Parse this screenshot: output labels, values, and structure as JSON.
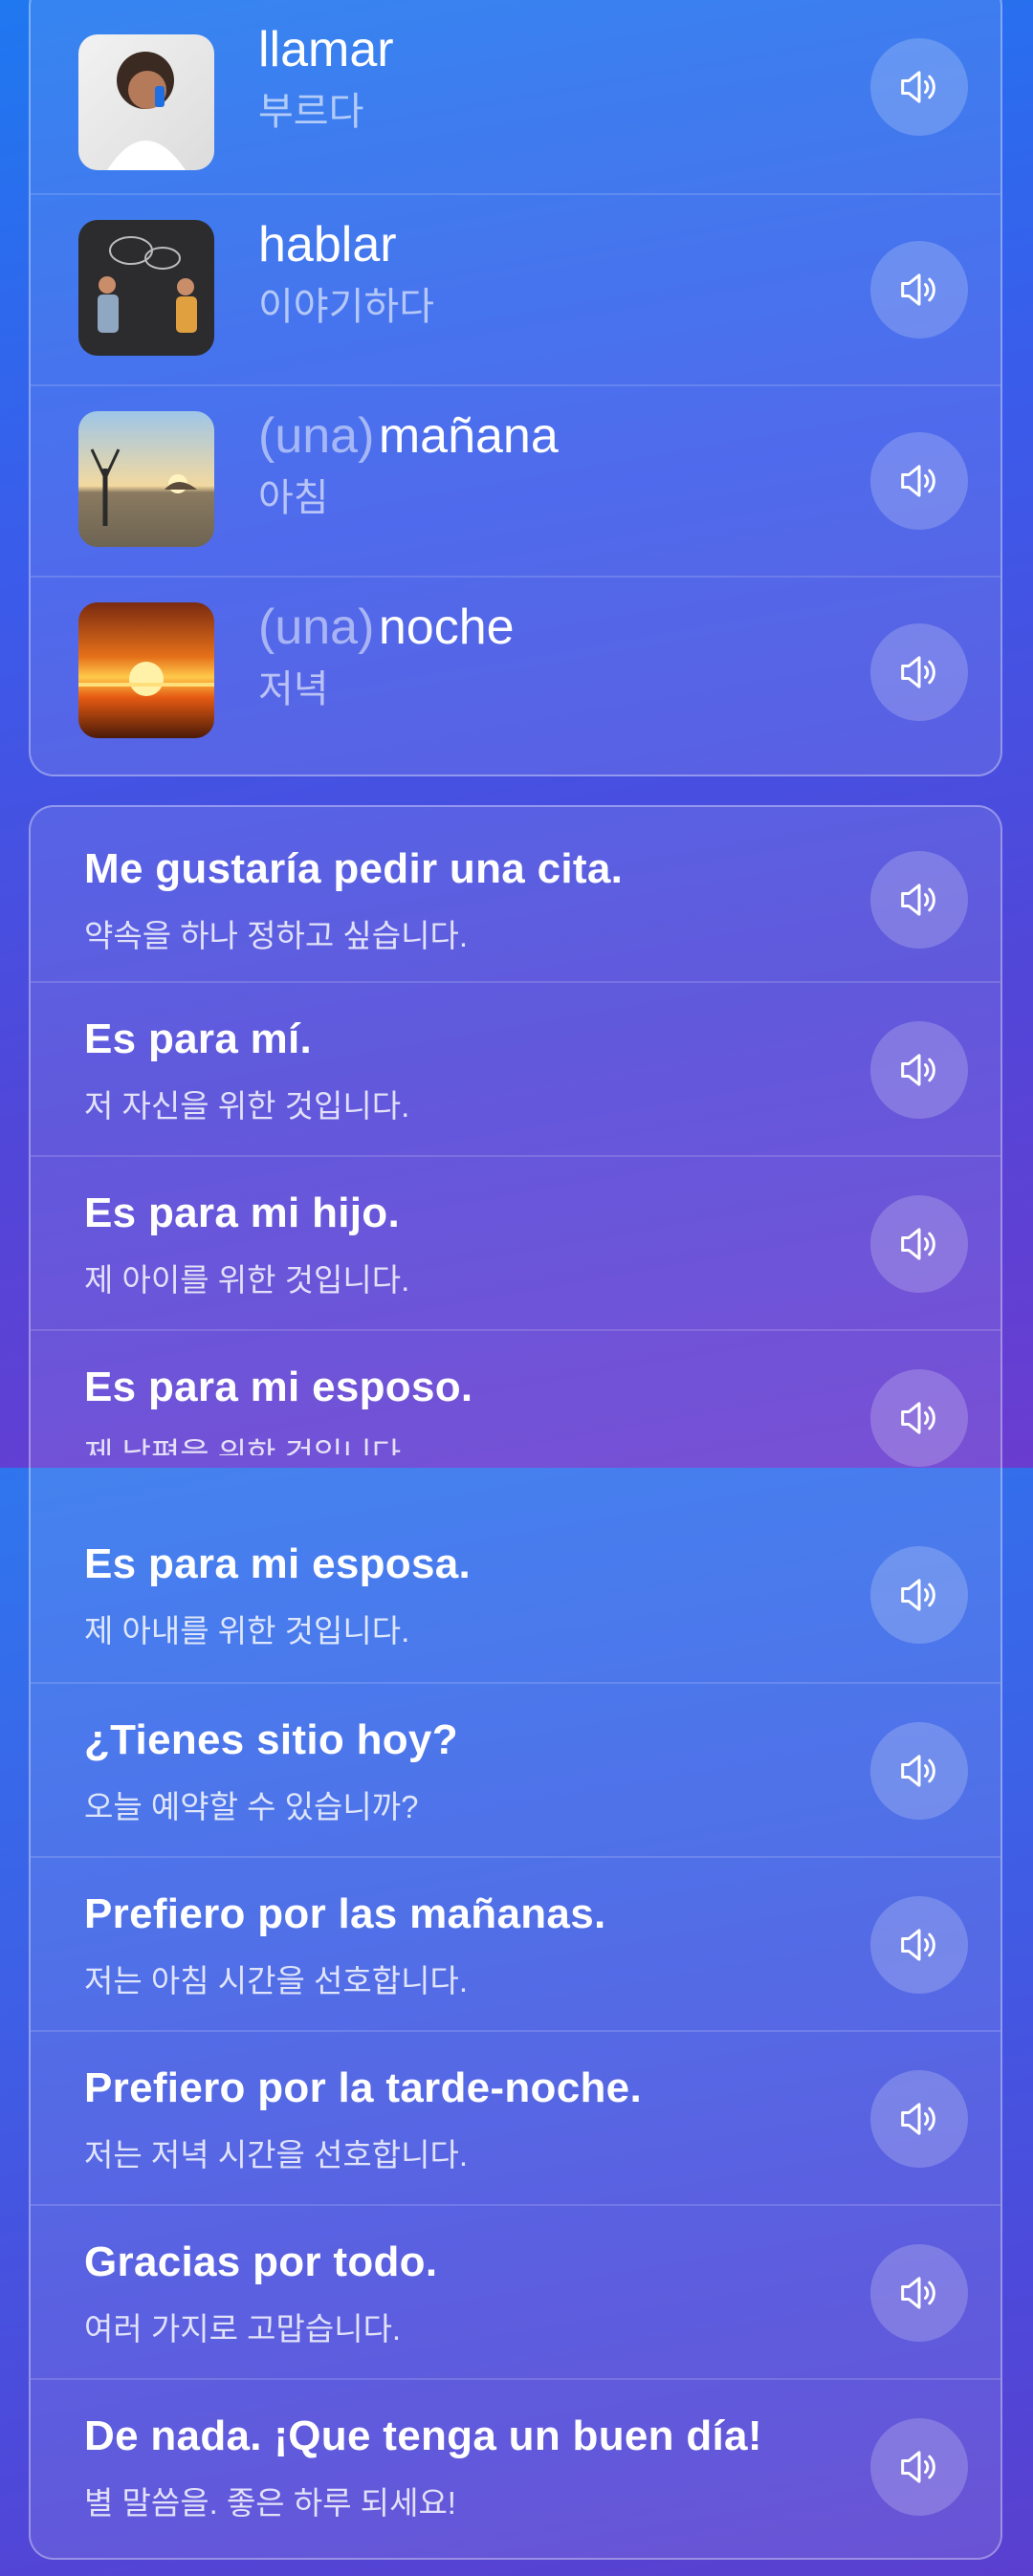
{
  "vocab": [
    {
      "article": "",
      "word": "llamar",
      "gloss": "부르다",
      "icon": "speaker-icon"
    },
    {
      "article": "",
      "word": "hablar",
      "gloss": "이야기하다",
      "icon": "speaker-icon"
    },
    {
      "article": "(una)",
      "word": "mañana",
      "gloss": "아침",
      "icon": "speaker-icon"
    },
    {
      "article": "(una)",
      "word": "noche",
      "gloss": "저녁",
      "icon": "speaker-icon"
    }
  ],
  "phrases": [
    {
      "es": "Me gustaría pedir una cita.",
      "ko": "약속을 하나 정하고 싶습니다."
    },
    {
      "es": "Es para mí.",
      "ko": "저 자신을 위한 것입니다."
    },
    {
      "es": "Es para mi hijo.",
      "ko": "제 아이를 위한 것입니다."
    },
    {
      "es": "Es para mi esposo.",
      "ko": "제 남편을 위한 것입니다."
    },
    {
      "es": "Es para mi esposa.",
      "ko": "제 아내를 위한 것입니다."
    },
    {
      "es": "¿Tienes sitio hoy?",
      "ko": "오늘 예약할 수 있습니까?"
    },
    {
      "es": "Prefiero por las mañanas.",
      "ko": "저는 아침 시간을 선호합니다."
    },
    {
      "es": "Prefiero por la tarde-noche.",
      "ko": "저는 저녁 시간을 선호합니다."
    },
    {
      "es": "Gracias por todo.",
      "ko": "여러 가지로 고맙습니다."
    },
    {
      "es": "De nada. ¡Que tenga un buen día!",
      "ko": "별 말씀을. 좋은 하루 되세요!"
    }
  ],
  "colors": {
    "accent_top": "#1f78f0",
    "accent_bottom": "#6a3cd0"
  }
}
